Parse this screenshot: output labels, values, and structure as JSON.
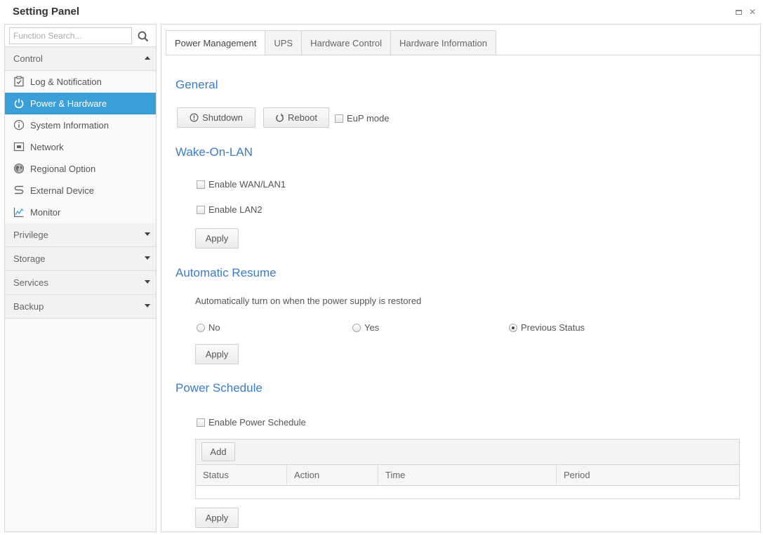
{
  "window": {
    "title": "Setting Panel"
  },
  "sidebar": {
    "search_placeholder": "Function Search...",
    "groups": [
      {
        "label": "Control",
        "expanded": true
      },
      {
        "label": "Privilege",
        "expanded": false
      },
      {
        "label": "Storage",
        "expanded": false
      },
      {
        "label": "Services",
        "expanded": false
      },
      {
        "label": "Backup",
        "expanded": false
      }
    ],
    "items": [
      {
        "label": "Log & Notification",
        "icon": "log-icon"
      },
      {
        "label": "Power & Hardware",
        "icon": "power-icon",
        "active": true
      },
      {
        "label": "System Information",
        "icon": "info-icon"
      },
      {
        "label": "Network",
        "icon": "network-icon"
      },
      {
        "label": "Regional Option",
        "icon": "globe-icon"
      },
      {
        "label": "External Device",
        "icon": "usb-icon"
      },
      {
        "label": "Monitor",
        "icon": "monitor-icon"
      }
    ]
  },
  "tabs": [
    {
      "label": "Power Management",
      "active": true
    },
    {
      "label": "UPS"
    },
    {
      "label": "Hardware Control"
    },
    {
      "label": "Hardware Information"
    }
  ],
  "general": {
    "title": "General",
    "shutdown_label": "Shutdown",
    "reboot_label": "Reboot",
    "eup_label": "EuP mode"
  },
  "wol": {
    "title": "Wake-On-LAN",
    "wan_lan1_label": "Enable WAN/LAN1",
    "lan2_label": "Enable LAN2",
    "apply_label": "Apply"
  },
  "resume": {
    "title": "Automatic Resume",
    "description": "Automatically turn on when the power supply is restored",
    "options": [
      {
        "label": "No",
        "selected": false
      },
      {
        "label": "Yes",
        "selected": false
      },
      {
        "label": "Previous Status",
        "selected": true
      }
    ],
    "apply_label": "Apply"
  },
  "schedule": {
    "title": "Power Schedule",
    "enable_label": "Enable Power Schedule",
    "add_label": "Add",
    "columns": [
      "Status",
      "Action",
      "Time",
      "Period"
    ],
    "apply_label": "Apply"
  },
  "colors": {
    "accent": "#3a9fd6",
    "section_title": "#3b7dc4"
  }
}
